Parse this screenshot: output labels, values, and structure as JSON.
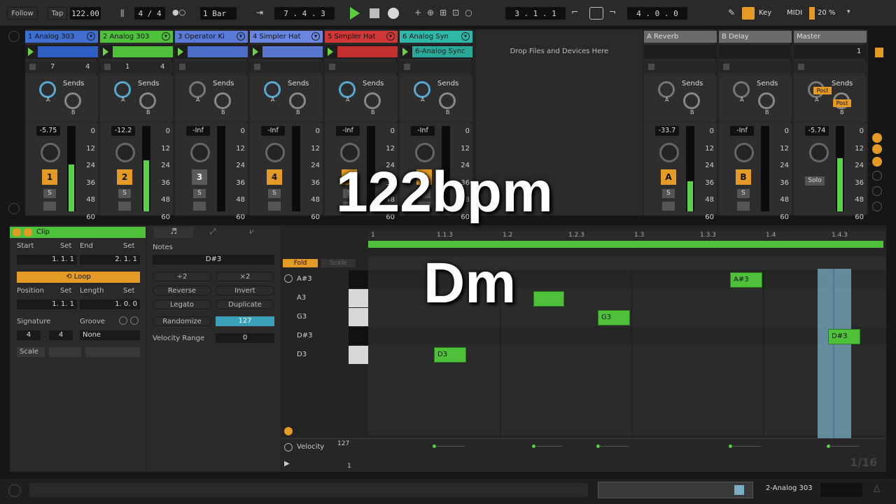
{
  "topbar": {
    "follow": "Follow",
    "tap": "Tap",
    "tempo": "122.00",
    "signature": "4 / 4",
    "quantize": "1 Bar",
    "position": "7 .   4 .   3",
    "loop_start": "3 .   1 .   1",
    "loop_length": "4 .   0 .   0",
    "key": "Key",
    "midi": "MIDI",
    "cpu": "20 %"
  },
  "tracks": [
    {
      "name": "1 Analog 303",
      "color": "#3f6fd0",
      "vol": "-5.75",
      "num": "1",
      "meter": 0.55,
      "clip_color": "#2f5fc2",
      "clip_label": "",
      "stop_l": "7",
      "stop_r": "4",
      "num_on": true
    },
    {
      "name": "2 Analog 303",
      "color": "#4fc03a",
      "vol": "-12.2",
      "num": "2",
      "meter": 0.6,
      "clip_color": "#4fc03a",
      "clip_label": "",
      "stop_l": "1",
      "stop_r": "4",
      "num_on": true
    },
    {
      "name": "3 Operator Ki",
      "color": "#5a7ad8",
      "vol": "-Inf",
      "num": "3",
      "meter": 0,
      "clip_color": "#4c6cc8",
      "clip_label": "",
      "stop_l": "",
      "stop_r": "",
      "num_on": false
    },
    {
      "name": "4 Simpler Hat",
      "color": "#6a86e0",
      "vol": "-Inf",
      "num": "4",
      "meter": 0,
      "clip_color": "#5a76d0",
      "clip_label": "",
      "stop_l": "",
      "stop_r": "",
      "num_on": true
    },
    {
      "name": "5 Simpler Hat",
      "color": "#d03838",
      "vol": "-Inf",
      "num": "5",
      "meter": 0,
      "clip_color": "#c43030",
      "clip_label": "",
      "stop_l": "",
      "stop_r": "",
      "num_on": true
    },
    {
      "name": "6 Analog Syn",
      "color": "#2fb8a8",
      "vol": "-Inf",
      "num": "6",
      "meter": 0,
      "clip_color": "#2aa898",
      "clip_label": "6-Analog Sync",
      "stop_l": "",
      "stop_r": "",
      "num_on": true
    }
  ],
  "returns": [
    {
      "name": "A Reverb",
      "vol": "-33.7",
      "num": "A",
      "meter": 0.35
    },
    {
      "name": "B Delay",
      "vol": "-Inf",
      "num": "B",
      "meter": 0
    }
  ],
  "master": {
    "name": "Master",
    "vol": "-5.74",
    "meter": 0.62,
    "solo": "Solo",
    "post1": "Post",
    "post2": "Post",
    "slot_num": "1"
  },
  "mixer": {
    "drop_text": "Drop Files and Devices Here",
    "sends_label": "Sends",
    "knob_a": "A",
    "knob_b": "B",
    "s_label": "S",
    "scale": [
      "0",
      "12",
      "24",
      "36",
      "48",
      "60"
    ]
  },
  "clip": {
    "title": "Clip",
    "start_label": "Start",
    "set": "Set",
    "end_label": "End",
    "start_val": "1.   1.   1",
    "end_val": "2.   1.   1",
    "loop": "Loop",
    "position_label": "Position",
    "length_label": "Length",
    "position_val": "1.   1.   1",
    "length_val": "1.   0.   0",
    "signature_label": "Signature",
    "groove_label": "Groove",
    "sig_num": "4",
    "sig_den": "4",
    "groove_val": "None",
    "scale_label": "Scale"
  },
  "notes_panel": {
    "title": "Notes",
    "note_val": "D#3",
    "btn_plus1": "÷2",
    "btn_plus2": "×2",
    "reverse": "Reverse",
    "invert": "Invert",
    "legato": "Legato",
    "duplicate": "Duplicate",
    "randomize": "Randomize",
    "rand_val": "127",
    "vel_range": "Velocity Range",
    "vel_range_val": "0"
  },
  "piano": {
    "fold": "Fold",
    "scale": "Scale",
    "keys": [
      "A#3",
      "A3",
      "G3",
      "D#3",
      "D3"
    ],
    "ruler": [
      "1",
      "1.1.3",
      "1.2",
      "1.2.3",
      "1.3",
      "1.3.3",
      "1.4",
      "1.4.3"
    ],
    "velocity_label": "Velocity",
    "vel_max": "127",
    "vel_min": "1",
    "grid": "1/16",
    "notes": [
      {
        "label": "D3"
      },
      {
        "label": ""
      },
      {
        "label": "G3"
      },
      {
        "label": "A#3"
      },
      {
        "label": "D#3"
      }
    ]
  },
  "bottom": {
    "track_name": "2-Analog 303"
  },
  "overlay": {
    "bpm": "122bpm",
    "key": "Dm"
  }
}
